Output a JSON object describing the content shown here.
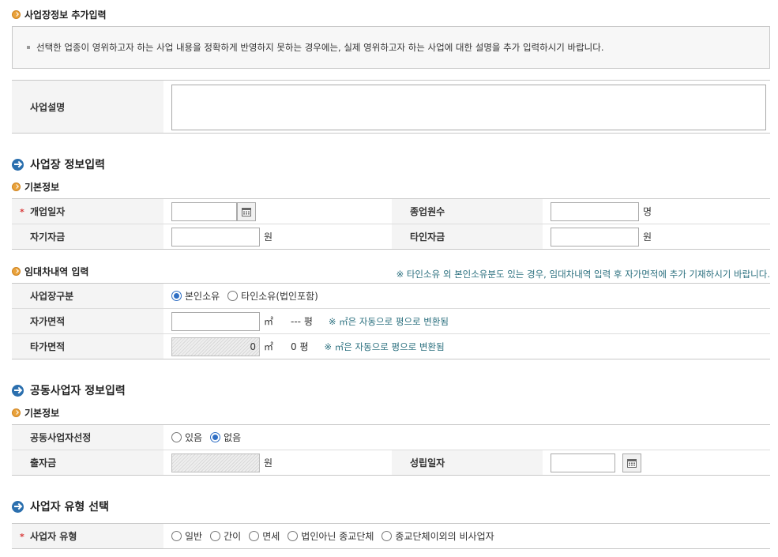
{
  "extra": {
    "title": "사업장정보 추가입력",
    "notice": "선택한 업종이 영위하고자 하는 사업 내용을 정확하게 반영하지 못하는 경우에는, 실제 영위하고자 하는 사업에 대한 설명을 추가 입력하시기 바랍니다.",
    "desc_label": "사업설명",
    "desc_value": ""
  },
  "workplace": {
    "title": "사업장 정보입력",
    "basic_title": "기본정보",
    "open_date_label": "개업일자",
    "open_date_value": "",
    "employees_label": "종업원수",
    "employees_value": "",
    "employees_unit": "명",
    "own_fund_label": "자기자금",
    "own_fund_value": "",
    "own_fund_unit": "원",
    "other_fund_label": "타인자금",
    "other_fund_value": "",
    "other_fund_unit": "원"
  },
  "lease": {
    "title": "임대차내역 입력",
    "notice": "※ 타인소유 외 본인소유분도 있는 경우, 임대차내역 입력 후 자가면적에 추가 기재하시기 바랍니다.",
    "type_label": "사업장구분",
    "type_options": [
      "본인소유",
      "타인소유(법인포함)"
    ],
    "type_selected": "본인소유",
    "own_area_label": "자가면적",
    "own_area_value": "",
    "area_unit": "㎡",
    "own_pyeong": "--- 평",
    "convert_note": "※ ㎡은 자동으로 평으로 변환됨",
    "other_area_label": "타가면적",
    "other_area_value": "0",
    "other_pyeong": "0 평"
  },
  "joint": {
    "title": "공동사업자 정보입력",
    "basic_title": "기본정보",
    "select_label": "공동사업자선정",
    "select_options": [
      "있음",
      "없음"
    ],
    "select_selected": "없음",
    "investment_label": "출자금",
    "investment_value": "",
    "investment_unit": "원",
    "founded_label": "성립일자",
    "founded_value": ""
  },
  "biztype": {
    "title": "사업자 유형 선택",
    "label": "사업자 유형",
    "options": [
      "일반",
      "간이",
      "면세",
      "법인아닌 종교단체",
      "종교단체이외의 비사업자"
    ],
    "selected": ""
  },
  "colors": {
    "accent_blue": "#2b6fae",
    "accent_orange": "#e9a23b",
    "required_red": "#d83a3a",
    "note_green": "#2a6f7e"
  },
  "icons": {
    "subtitle": "orange-bullet-icon",
    "section": "blue-arrow-circle-icon",
    "date": "calendar-icon"
  }
}
